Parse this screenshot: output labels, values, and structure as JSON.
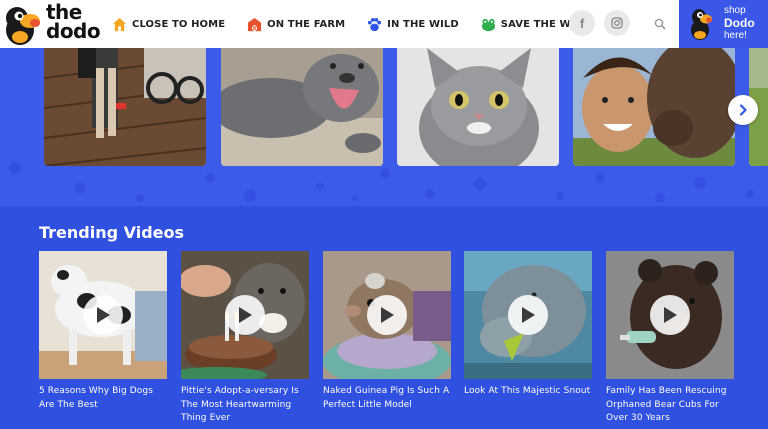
{
  "brand": {
    "logo_text_line1": "the",
    "logo_text_line2": "dodo"
  },
  "nav": {
    "items": [
      {
        "label": "CLOSE TO HOME",
        "icon": "house-icon",
        "color": "#f5a623"
      },
      {
        "label": "ON THE FARM",
        "icon": "barn-icon",
        "color": "#e8532f"
      },
      {
        "label": "IN THE WILD",
        "icon": "paw-icon",
        "color": "#2f55e4"
      },
      {
        "label": "SAVE THE WILD",
        "icon": "frog-icon",
        "color": "#2fae4e"
      }
    ],
    "social": {
      "facebook_glyph": "f",
      "instagram_icon": "instagram-icon"
    },
    "search_icon": "search-icon",
    "shop": {
      "line1": "shop",
      "line2": "Dodo",
      "line3": "here!"
    }
  },
  "colors": {
    "brand_blue": "#3a57e8",
    "trending_bg": "#3050e0",
    "white": "#ffffff"
  },
  "trending": {
    "title": "Trending Videos",
    "videos": [
      {
        "title": "5 Reasons Why Big Dogs Are The Best"
      },
      {
        "title": "Pittie's Adopt-a-versary Is The Most Heartwarming Thing Ever"
      },
      {
        "title": "Naked Guinea Pig Is Such A Perfect Little Model"
      },
      {
        "title": "Look At This Majestic Snout"
      },
      {
        "title": "Family Has Been Rescuing Orphaned Bear Cubs For Over 30 Years"
      }
    ]
  }
}
